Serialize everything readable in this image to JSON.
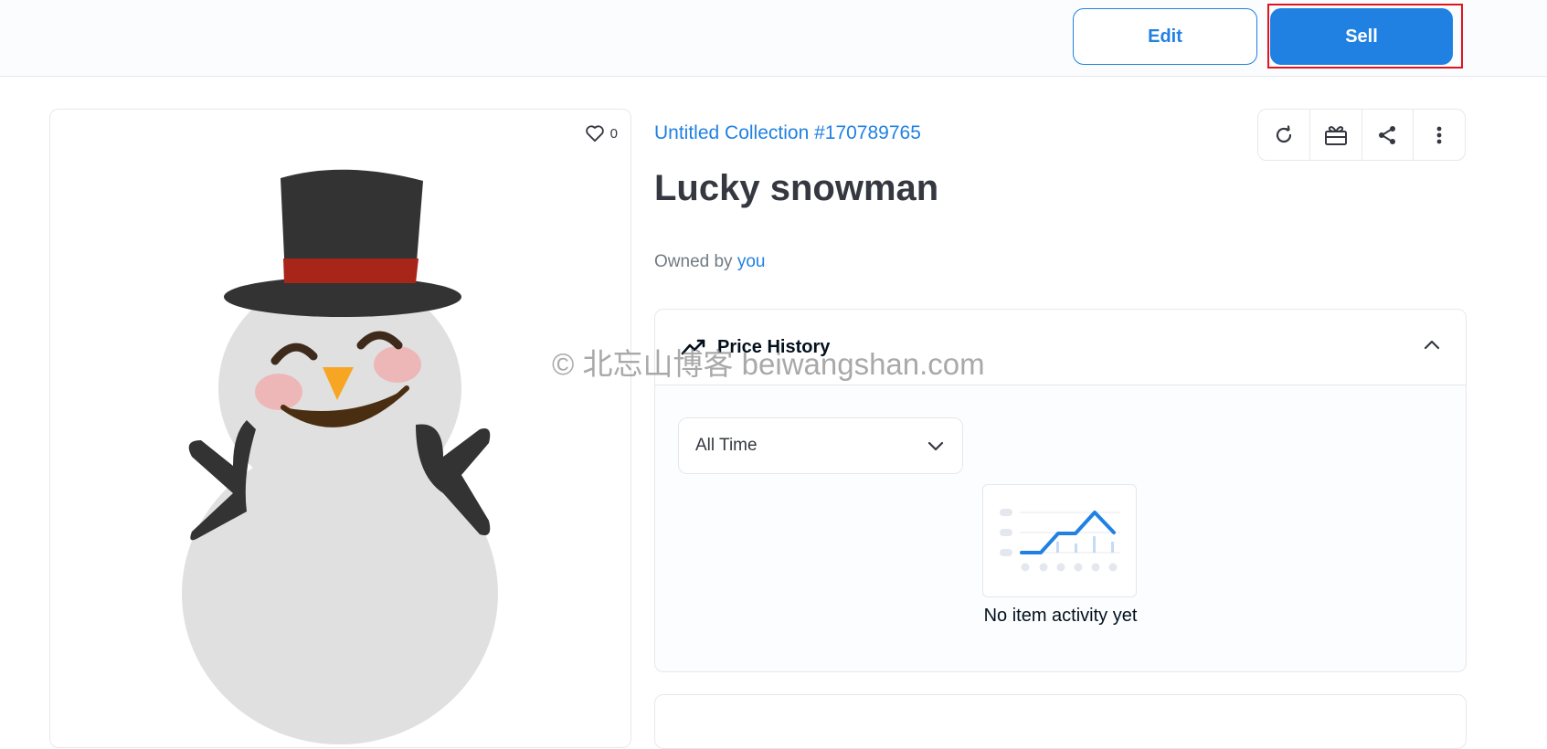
{
  "toolbar": {
    "edit_label": "Edit",
    "sell_label": "Sell"
  },
  "item": {
    "favorite_count": "0",
    "collection": "Untitled Collection #170789765",
    "name": "Lucky snowman",
    "owned_prefix": "Owned by",
    "owner": "you"
  },
  "actions": [
    "refresh-icon",
    "gift-icon",
    "share-icon",
    "more-icon"
  ],
  "price_history": {
    "title": "Price History",
    "range_selected": "All Time",
    "empty_message": "No item activity yet"
  },
  "watermark": "© 北忘山博客 beiwangshan.com",
  "colors": {
    "accent": "#2081e2",
    "highlight": "#e0141e"
  }
}
